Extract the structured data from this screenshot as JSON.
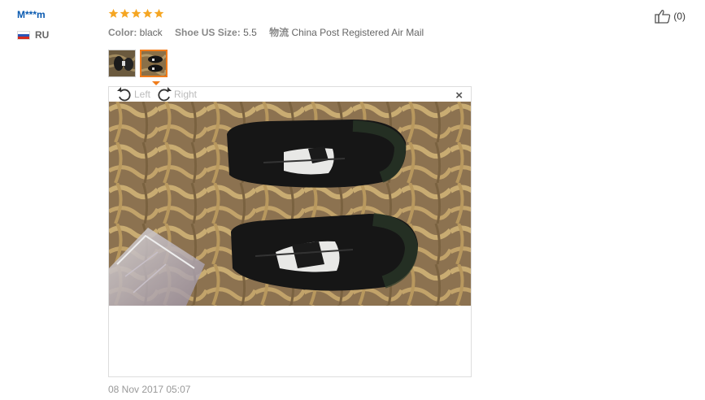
{
  "reviewer": {
    "name": "M***m",
    "country": "RU"
  },
  "review": {
    "rating": 5,
    "attributes": [
      {
        "key": "Color:",
        "value": "black"
      },
      {
        "key": "Shoe US Size:",
        "value": "5.5"
      },
      {
        "key": "物流",
        "value": "China Post Registered Air Mail"
      }
    ],
    "date": "08 Nov 2017 05:07"
  },
  "viewer": {
    "rotate_left": "Left",
    "rotate_right": "Right",
    "close": "×"
  },
  "helpful": {
    "count": "(0)"
  },
  "colors": {
    "star": "#f5a623",
    "name": "#0a5ab0",
    "active_thumb": "#f07c1b"
  },
  "icons": [
    "star-icon",
    "rotate-left-icon",
    "rotate-right-icon",
    "close-icon",
    "thumbs-up-icon",
    "flag-ru-icon"
  ]
}
